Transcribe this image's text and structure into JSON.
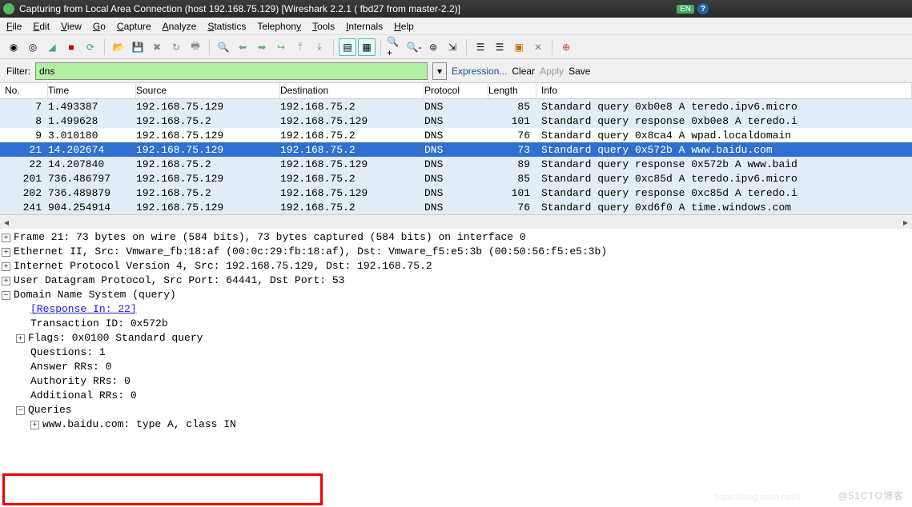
{
  "title": "Capturing from Local Area Connection  (host 192.168.75.129)  [Wireshark 2.2.1 (          fbd27 from master-2.2)]",
  "lang_badge": "EN",
  "menu": [
    "File",
    "Edit",
    "View",
    "Go",
    "Capture",
    "Analyze",
    "Statistics",
    "Telephony",
    "Tools",
    "Internals",
    "Help"
  ],
  "filter": {
    "label": "Filter:",
    "value": "dns",
    "expression": "Expression...",
    "clear": "Clear",
    "apply": "Apply",
    "save": "Save"
  },
  "columns": {
    "no": "No.",
    "time": "Time",
    "src": "Source",
    "dst": "Destination",
    "proto": "Protocol",
    "len": "Length",
    "info": "Info"
  },
  "packets": [
    {
      "no": "7",
      "time": "1.493387",
      "src": "192.168.75.129",
      "dst": "192.168.75.2",
      "proto": "DNS",
      "len": "85",
      "info": "Standard query 0xb0e8 A teredo.ipv6.micro",
      "cls": "blue"
    },
    {
      "no": "8",
      "time": "1.499628",
      "src": "192.168.75.2",
      "dst": "192.168.75.129",
      "proto": "DNS",
      "len": "101",
      "info": "Standard query response 0xb0e8 A teredo.i",
      "cls": "blue"
    },
    {
      "no": "9",
      "time": "3.010180",
      "src": "192.168.75.129",
      "dst": "192.168.75.2",
      "proto": "DNS",
      "len": "76",
      "info": "Standard query 0x8ca4 A wpad.localdomain",
      "cls": ""
    },
    {
      "no": "21",
      "time": "14.202674",
      "src": "192.168.75.129",
      "dst": "192.168.75.2",
      "proto": "DNS",
      "len": "73",
      "info": "Standard query 0x572b A www.baidu.com",
      "cls": "sel"
    },
    {
      "no": "22",
      "time": "14.207840",
      "src": "192.168.75.2",
      "dst": "192.168.75.129",
      "proto": "DNS",
      "len": "89",
      "info": "Standard query response 0x572b A www.baid",
      "cls": "blue"
    },
    {
      "no": "201",
      "time": "736.486797",
      "src": "192.168.75.129",
      "dst": "192.168.75.2",
      "proto": "DNS",
      "len": "85",
      "info": "Standard query 0xc85d A teredo.ipv6.micro",
      "cls": "blue"
    },
    {
      "no": "202",
      "time": "736.489879",
      "src": "192.168.75.2",
      "dst": "192.168.75.129",
      "proto": "DNS",
      "len": "101",
      "info": "Standard query response 0xc85d A teredo.i",
      "cls": "blue"
    },
    {
      "no": "241",
      "time": "904.254914",
      "src": "192.168.75.129",
      "dst": "192.168.75.2",
      "proto": "DNS",
      "len": "76",
      "info": "Standard query 0xd6f0 A time.windows.com",
      "cls": "blue"
    }
  ],
  "details": {
    "l1": "Frame 21: 73 bytes on wire (584 bits), 73 bytes captured (584 bits) on interface 0",
    "l2": "Ethernet II, Src: Vmware_fb:18:af (00:0c:29:fb:18:af), Dst: Vmware_f5:e5:3b (00:50:56:f5:e5:3b)",
    "l3": "Internet Protocol Version 4, Src: 192.168.75.129, Dst: 192.168.75.2",
    "l4": "User Datagram Protocol, Src Port: 64441, Dst Port: 53",
    "l5": "Domain Name System (query)",
    "l6": "[Response In: 22]",
    "l7": "Transaction ID: 0x572b",
    "l8": "Flags: 0x0100 Standard query",
    "l9": "Questions: 1",
    "l10": "Answer RRs: 0",
    "l11": "Authority RRs: 0",
    "l12": "Additional RRs: 0",
    "l13": "Queries",
    "l14": "www.baidu.com: type A, class IN"
  },
  "watermark": "@51CTO博客"
}
